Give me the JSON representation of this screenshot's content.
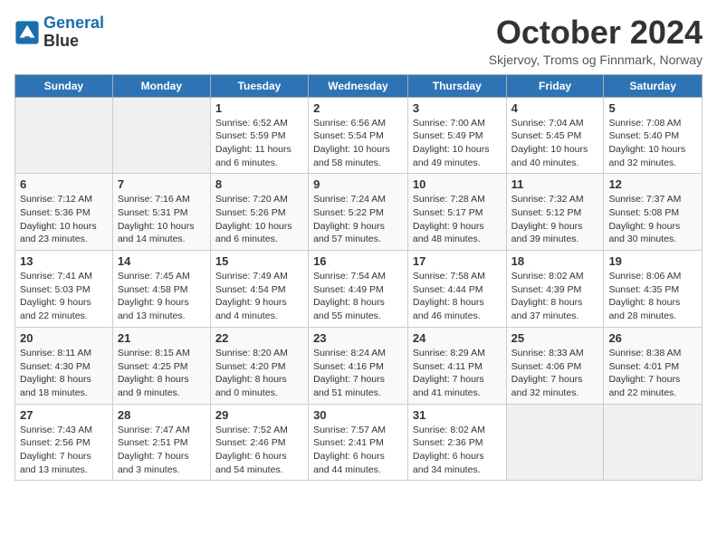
{
  "logo": {
    "line1": "General",
    "line2": "Blue"
  },
  "title": "October 2024",
  "subtitle": "Skjervoy, Troms og Finnmark, Norway",
  "weekdays": [
    "Sunday",
    "Monday",
    "Tuesday",
    "Wednesday",
    "Thursday",
    "Friday",
    "Saturday"
  ],
  "weeks": [
    [
      {
        "day": "",
        "info": ""
      },
      {
        "day": "",
        "info": ""
      },
      {
        "day": "1",
        "info": "Sunrise: 6:52 AM\nSunset: 5:59 PM\nDaylight: 11 hours and 6 minutes."
      },
      {
        "day": "2",
        "info": "Sunrise: 6:56 AM\nSunset: 5:54 PM\nDaylight: 10 hours and 58 minutes."
      },
      {
        "day": "3",
        "info": "Sunrise: 7:00 AM\nSunset: 5:49 PM\nDaylight: 10 hours and 49 minutes."
      },
      {
        "day": "4",
        "info": "Sunrise: 7:04 AM\nSunset: 5:45 PM\nDaylight: 10 hours and 40 minutes."
      },
      {
        "day": "5",
        "info": "Sunrise: 7:08 AM\nSunset: 5:40 PM\nDaylight: 10 hours and 32 minutes."
      }
    ],
    [
      {
        "day": "6",
        "info": "Sunrise: 7:12 AM\nSunset: 5:36 PM\nDaylight: 10 hours and 23 minutes."
      },
      {
        "day": "7",
        "info": "Sunrise: 7:16 AM\nSunset: 5:31 PM\nDaylight: 10 hours and 14 minutes."
      },
      {
        "day": "8",
        "info": "Sunrise: 7:20 AM\nSunset: 5:26 PM\nDaylight: 10 hours and 6 minutes."
      },
      {
        "day": "9",
        "info": "Sunrise: 7:24 AM\nSunset: 5:22 PM\nDaylight: 9 hours and 57 minutes."
      },
      {
        "day": "10",
        "info": "Sunrise: 7:28 AM\nSunset: 5:17 PM\nDaylight: 9 hours and 48 minutes."
      },
      {
        "day": "11",
        "info": "Sunrise: 7:32 AM\nSunset: 5:12 PM\nDaylight: 9 hours and 39 minutes."
      },
      {
        "day": "12",
        "info": "Sunrise: 7:37 AM\nSunset: 5:08 PM\nDaylight: 9 hours and 30 minutes."
      }
    ],
    [
      {
        "day": "13",
        "info": "Sunrise: 7:41 AM\nSunset: 5:03 PM\nDaylight: 9 hours and 22 minutes."
      },
      {
        "day": "14",
        "info": "Sunrise: 7:45 AM\nSunset: 4:58 PM\nDaylight: 9 hours and 13 minutes."
      },
      {
        "day": "15",
        "info": "Sunrise: 7:49 AM\nSunset: 4:54 PM\nDaylight: 9 hours and 4 minutes."
      },
      {
        "day": "16",
        "info": "Sunrise: 7:54 AM\nSunset: 4:49 PM\nDaylight: 8 hours and 55 minutes."
      },
      {
        "day": "17",
        "info": "Sunrise: 7:58 AM\nSunset: 4:44 PM\nDaylight: 8 hours and 46 minutes."
      },
      {
        "day": "18",
        "info": "Sunrise: 8:02 AM\nSunset: 4:39 PM\nDaylight: 8 hours and 37 minutes."
      },
      {
        "day": "19",
        "info": "Sunrise: 8:06 AM\nSunset: 4:35 PM\nDaylight: 8 hours and 28 minutes."
      }
    ],
    [
      {
        "day": "20",
        "info": "Sunrise: 8:11 AM\nSunset: 4:30 PM\nDaylight: 8 hours and 18 minutes."
      },
      {
        "day": "21",
        "info": "Sunrise: 8:15 AM\nSunset: 4:25 PM\nDaylight: 8 hours and 9 minutes."
      },
      {
        "day": "22",
        "info": "Sunrise: 8:20 AM\nSunset: 4:20 PM\nDaylight: 8 hours and 0 minutes."
      },
      {
        "day": "23",
        "info": "Sunrise: 8:24 AM\nSunset: 4:16 PM\nDaylight: 7 hours and 51 minutes."
      },
      {
        "day": "24",
        "info": "Sunrise: 8:29 AM\nSunset: 4:11 PM\nDaylight: 7 hours and 41 minutes."
      },
      {
        "day": "25",
        "info": "Sunrise: 8:33 AM\nSunset: 4:06 PM\nDaylight: 7 hours and 32 minutes."
      },
      {
        "day": "26",
        "info": "Sunrise: 8:38 AM\nSunset: 4:01 PM\nDaylight: 7 hours and 22 minutes."
      }
    ],
    [
      {
        "day": "27",
        "info": "Sunrise: 7:43 AM\nSunset: 2:56 PM\nDaylight: 7 hours and 13 minutes."
      },
      {
        "day": "28",
        "info": "Sunrise: 7:47 AM\nSunset: 2:51 PM\nDaylight: 7 hours and 3 minutes."
      },
      {
        "day": "29",
        "info": "Sunrise: 7:52 AM\nSunset: 2:46 PM\nDaylight: 6 hours and 54 minutes."
      },
      {
        "day": "30",
        "info": "Sunrise: 7:57 AM\nSunset: 2:41 PM\nDaylight: 6 hours and 44 minutes."
      },
      {
        "day": "31",
        "info": "Sunrise: 8:02 AM\nSunset: 2:36 PM\nDaylight: 6 hours and 34 minutes."
      },
      {
        "day": "",
        "info": ""
      },
      {
        "day": "",
        "info": ""
      }
    ]
  ]
}
